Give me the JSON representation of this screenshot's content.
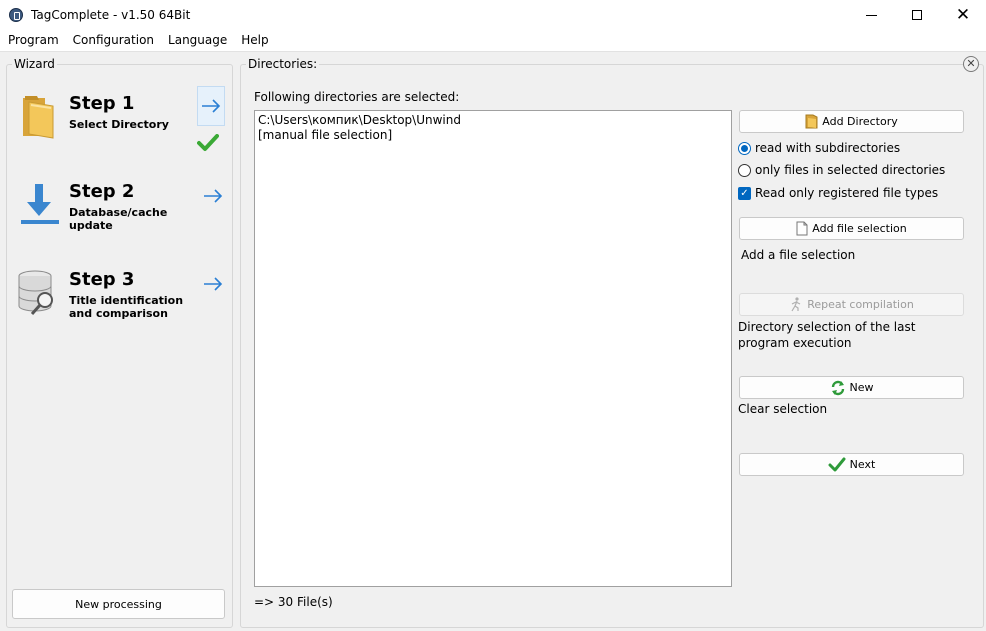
{
  "window": {
    "title": "TagComplete - v1.50 64Bit"
  },
  "menu": [
    "Program",
    "Configuration",
    "Language",
    "Help"
  ],
  "wizard": {
    "label": "Wizard",
    "steps": [
      {
        "title": "Step 1",
        "subtitle": "Select Directory",
        "icon": "folder-icon",
        "active": true,
        "done": true
      },
      {
        "title": "Step 2",
        "subtitle": "Database/cache update",
        "icon": "download-icon",
        "active": false,
        "done": false
      },
      {
        "title": "Step 3",
        "subtitle": "Title identification and comparison",
        "icon": "database-search-icon",
        "active": false,
        "done": false
      }
    ],
    "new_processing": "New processing"
  },
  "directories": {
    "label": "Directories:",
    "following": "Following directories are selected:",
    "list": [
      "C:\\Users\\компик\\Desktop\\Unwind",
      "[manual file selection]"
    ],
    "file_count": "=> 30 File(s)"
  },
  "options": {
    "add_directory": "Add Directory",
    "read_subdirs": "read with subdirectories",
    "only_selected": "only files in selected directories",
    "registered_types": "Read only registered file types",
    "add_file_selection": "Add file selection",
    "add_file_selection_desc": "Add a file selection",
    "repeat_compilation": "Repeat compilation",
    "repeat_desc": "Directory selection of the last program execution",
    "new_label": "New",
    "new_desc": "Clear selection",
    "next_label": "Next"
  },
  "colors": {
    "accent": "#0067c0",
    "arrow": "#2a7fd4",
    "check": "#3aa935"
  }
}
